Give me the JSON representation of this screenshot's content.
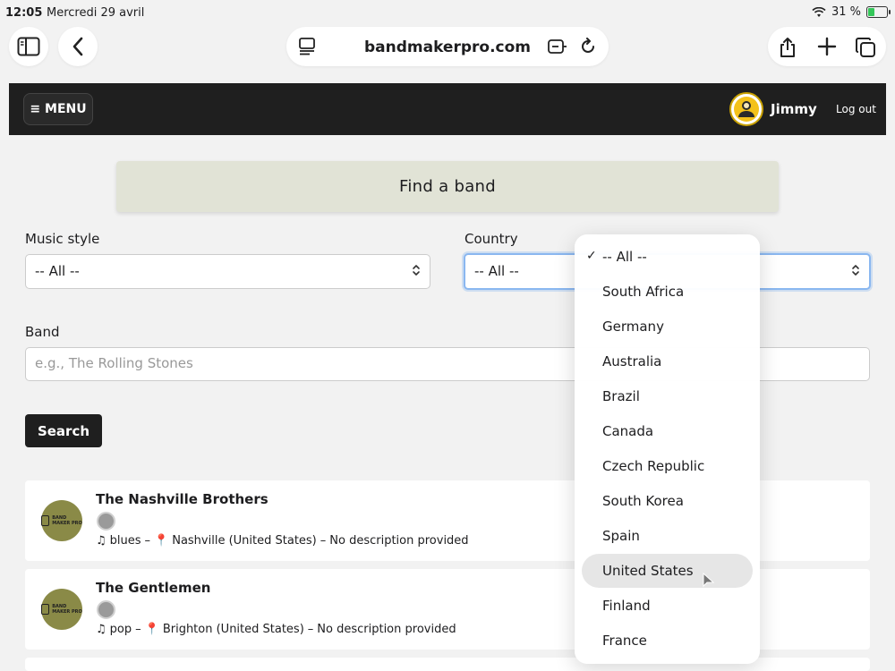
{
  "status_bar": {
    "time": "12:05",
    "date": "Mercredi 29 avril",
    "battery": "31 %"
  },
  "browser": {
    "url": "bandmakerpro.com"
  },
  "header": {
    "menu_label": "≡ MENU",
    "username": "Jimmy",
    "logout_label": "Log out"
  },
  "page": {
    "title": "Find a band"
  },
  "filters": {
    "music_style_label": "Music style",
    "music_style_value": "-- All --",
    "country_label": "Country",
    "country_value": "-- All --",
    "band_label": "Band",
    "band_placeholder": "e.g., The Rolling Stones",
    "search_label": "Search"
  },
  "results": [
    {
      "name": "The Nashville Brothers",
      "style": "blues",
      "location": "Nashville (United States)",
      "description": "No description provided"
    },
    {
      "name": "The Gentlemen",
      "style": "pop",
      "location": "Brighton (United States)",
      "description": "No description provided"
    }
  ],
  "country_dropdown": {
    "options": [
      "-- All --",
      "South Africa",
      "Germany",
      "Australia",
      "Brazil",
      "Canada",
      "Czech Republic",
      "South Korea",
      "Spain",
      "United States",
      "Finland",
      "France"
    ],
    "selected": "-- All --",
    "highlighted": "United States"
  },
  "logo_text": "BAND MAKER PRO"
}
